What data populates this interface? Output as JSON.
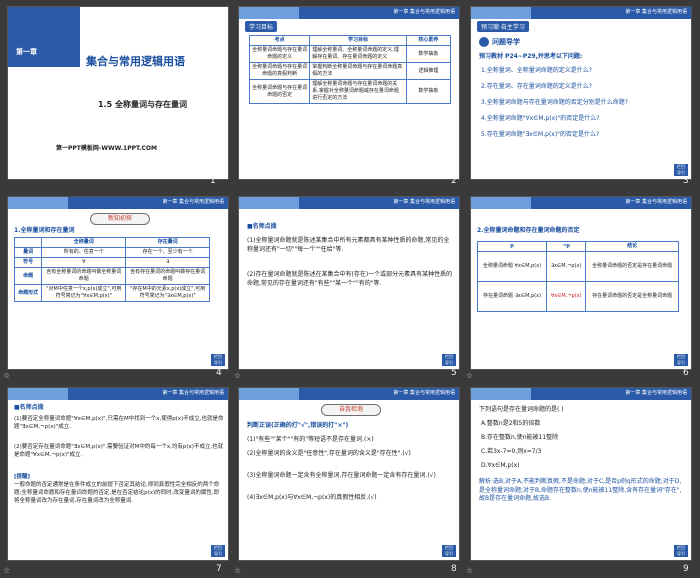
{
  "slides": [
    {
      "num": "1",
      "title": "集合与常用逻辑用语",
      "badge": "第一章",
      "section": "1.5  全称量词与存在量词",
      "footer": "第一PPT模板网-WWW.1PPT.COM"
    },
    {
      "num": "2",
      "tag": "学习目标",
      "chapter": "第一章  集合与常用逻辑用语",
      "headers": [
        "考点",
        "学习目标",
        "核心素养"
      ],
      "rows": [
        [
          "全称量词命题与存在量词命题的定义",
          "理解全称量词、全称量词命题的定义,理解存在量词、存在量词命题的定义",
          "数学抽象"
        ],
        [
          "全称量词命题与存在量词命题的真假判断",
          "掌握判断全称量词命题与存在量词命题真假的方法",
          "逻辑推理"
        ],
        [
          "全称量词命题与存在量词命题的否定",
          "理解全称量词命题与存在量词命题的关系,掌握对全称量词命题或存在量词命题进行否定的方法",
          "数学抽象"
        ]
      ]
    },
    {
      "num": "3",
      "tag": "预习案·自主学习",
      "chapter": "第一章  集合与常用逻辑用语",
      "subtitle": "问题导学",
      "intro": "预习教材 P24~P29,并思考以下问题:",
      "items": [
        "1.全称量词、全称量词命题的定义是什么?",
        "2.存在量词、存在量词命题的定义是什么?",
        "3.全称量词命题与存在量词命题的否定分别是什么命题?",
        "4.全称量词命题\"∀x∈M,p(x)\"的否定是什么?",
        "5.存在量词命题\"∃x∈M,p(x)\"的否定是什么?"
      ]
    },
    {
      "num": "4",
      "tag": "新知初探",
      "chapter": "第一章  集合与常用逻辑用语",
      "heading": "1.全称量词和存在量词",
      "col1": "全称量词",
      "col2": "存在量词",
      "r_label": [
        "量词",
        "符号",
        "命题",
        "命题形式"
      ],
      "r1": [
        "所有的、任意一个",
        "存在一个、至少有一个"
      ],
      "r2": [
        "∀",
        "∃"
      ],
      "r3": [
        "含有全称量词的命题叫做全称量词命题",
        "含有存在量词的命题叫做存在量词命题"
      ],
      "r4": [
        "\"对M中任意一个x,p(x)成立\",可用符号简记为\"∀x∈M,p(x)\"",
        "\"存在M中的元素x,p(x)成立\",可用符号简记为\"∃x∈M,p(x)\""
      ]
    },
    {
      "num": "5",
      "chapter": "第一章  集合与常用逻辑用语",
      "heading": "■名师点拨",
      "p1": "(1)全称量词命题就是陈述某集合中所有元素都具有某种性质的命题,常见的全称量词还有\"一切\"\"每一个\"\"任给\"等.",
      "p2": "(2)存在量词命题就是陈述在某集合中有(存在)一个或部分元素具有某种性质的命题,常见的存在量词还有\"有些\"\"某一个\"\"有的\"等."
    },
    {
      "num": "6",
      "chapter": "第一章  集合与常用逻辑用语",
      "heading": "2.全称量词命题和存在量词命题的否定",
      "h": [
        "p",
        "¬p",
        "结论"
      ],
      "r1": [
        "全称量词命题 ∀x∈M,p(x)",
        "∃x∈M,¬p(x)",
        "全称量词命题的否定是存在量词命题"
      ],
      "r2": [
        "存在量词命题 ∃x∈M,p(x)",
        "∀x∈M,¬p(x)",
        "存在量词命题的否定是全称量词命题"
      ]
    },
    {
      "num": "7",
      "chapter": "第一章  集合与常用逻辑用语",
      "heading": "■名师点拨",
      "p1": "(1)要否定全称量词命题\"∀x∈M,p(x)\",只需在M中找到一个x,使得p(x)不成立,也就是命题\"∃x∈M,¬p(x)\"成立.",
      "p2": "(2)要否定存在量词命题\"∃x∈M,p(x)\",需要验证对M中的每一个x,均有p(x)不成立,也就是命题\"∀x∈M,¬p(x)\"成立.",
      "tip_label": "[提醒]",
      "p3": "一般命题的否定通常是在条件成立的前提下否定其结论,得到真假性完全相反的两个命题;全称量词命题和存在量词命题的否定,是在否定结论p(x)的同时,改变量词的属性,即将全称量词改为存在量词,存在量词改为全称量词."
    },
    {
      "num": "8",
      "chapter": "第一章  集合与常用逻辑用语",
      "tag": "自我检测",
      "intro": "判断正误(正确的打\"√\",错误的打\"×\")",
      "items": [
        "(1)\"有些\"\"某个\"\"有的\"等短语不是存在量词.(×)",
        "(2)全称量词的含义是\"任意性\",存在量词的含义是\"存在性\".(√)",
        "(3)全称量词命题一定含有全称量词,存在量词命题一定含有存在量词.(√)",
        "(4)∃x∈M,p(x)与∀x∈M,¬p(x)的真假性相反.(√)"
      ]
    },
    {
      "num": "9",
      "chapter": "第一章  集合与常用逻辑用语",
      "q": "下列语句是存在量词命题的是(  )",
      "opts": [
        "A.整数n是2和5的倍数",
        "B.存在整数n,使n能被11整除",
        "C.若3x-7=0,则x=7/3",
        "D.∀x∈M,p(x)"
      ],
      "ans": "解析:选B.对于A,不能判断真假,不是命题;对于C,是否p则q形式的命题;对于D,是全称量词命题;对于B,命题存在整数n,使n能被11整除,含有存在量词\"存在\",故B是存在量词命题,故选B."
    }
  ]
}
